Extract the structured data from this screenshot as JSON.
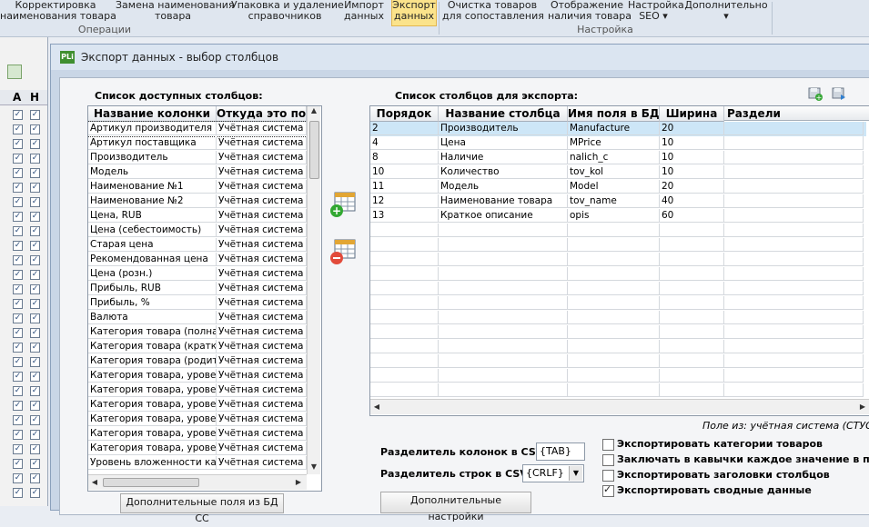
{
  "ribbon": {
    "buttons": [
      {
        "label": "Корректировка\nнаименования товара",
        "active": false
      },
      {
        "label": "Замена наименования\nтовара",
        "active": false
      },
      {
        "label": "Упаковка и удаление\nсправочников",
        "active": false
      },
      {
        "label": "Импорт\nданных",
        "active": false
      },
      {
        "label": "Экспорт\nданных",
        "active": true
      },
      {
        "label": "Очистка товаров\nдля сопоставления",
        "active": false
      },
      {
        "label": "Отображение\nналичия товара",
        "active": false
      },
      {
        "label": "Настройка\nSEO ▾",
        "active": false
      },
      {
        "label": "Дополнительно\n▾",
        "active": false
      }
    ],
    "groups": {
      "operations": "Операции",
      "settings": "Настройка"
    }
  },
  "background": {
    "col_a": "A",
    "col_h": "H"
  },
  "dialog": {
    "app_icon": "PLi",
    "title": "Экспорт данных - выбор столбцов",
    "left_label": "Список доступных столбцов:",
    "right_label": "Список столбцов для экспорта:",
    "left_grid": {
      "headers": [
        "Название колонки",
        "Откуда это пол"
      ],
      "rows": [
        [
          "Артикул производителя",
          "Учётная система"
        ],
        [
          "Артикул поставщика",
          "Учётная система"
        ],
        [
          "Производитель",
          "Учётная система"
        ],
        [
          "Модель",
          "Учётная система"
        ],
        [
          "Наименование №1",
          "Учётная система"
        ],
        [
          "Наименование №2",
          "Учётная система"
        ],
        [
          "Цена, RUB",
          "Учётная система"
        ],
        [
          "Цена (себестоимость)",
          "Учётная система"
        ],
        [
          "Старая цена",
          "Учётная система"
        ],
        [
          "Рекомендованная цена",
          "Учётная система"
        ],
        [
          "Цена (розн.)",
          "Учётная система"
        ],
        [
          "Прибыль, RUB",
          "Учётная система"
        ],
        [
          "Прибыль, %",
          "Учётная система"
        ],
        [
          "Валюта",
          "Учётная система"
        ],
        [
          "Категория товара (полная)",
          "Учётная система"
        ],
        [
          "Категория товара (кратка",
          "Учётная система"
        ],
        [
          "Категория товара (родите",
          "Учётная система"
        ],
        [
          "Категория товара, уровень",
          "Учётная система"
        ],
        [
          "Категория товара, уровень",
          "Учётная система"
        ],
        [
          "Категория товара, уровень",
          "Учётная система"
        ],
        [
          "Категория товара, уровень",
          "Учётная система"
        ],
        [
          "Категория товара, уровень",
          "Учётная система"
        ],
        [
          "Категория товара, уровень",
          "Учётная система"
        ],
        [
          "Уровень вложенности кате",
          "Учётная система"
        ]
      ]
    },
    "right_grid": {
      "headers": [
        "Порядок",
        "Название столбца",
        "Имя поля в БД",
        "Ширина",
        "Раздели"
      ],
      "rows": [
        [
          "2",
          "Производитель",
          "Manufacture",
          "20",
          ""
        ],
        [
          "4",
          "Цена",
          "MPrice",
          "10",
          ""
        ],
        [
          "8",
          "Наличие",
          "nalich_c",
          "10",
          ""
        ],
        [
          "10",
          "Количество",
          "tov_kol",
          "10",
          ""
        ],
        [
          "11",
          "Модель",
          "Model",
          "20",
          ""
        ],
        [
          "12",
          "Наименование товара",
          "tov_name",
          "40",
          ""
        ],
        [
          "13",
          "Краткое описание",
          "opis",
          "60",
          ""
        ]
      ]
    },
    "field_source": "Поле из:   учётная система (СТУС)",
    "col_sep_label": "Разделитель колонок в CSV:",
    "col_sep_value": "{TAB}",
    "row_sep_label": "Разделитель строк в CSV:",
    "row_sep_value": "{CRLF}",
    "checkboxes": [
      {
        "label": "Экспортировать категории товаров",
        "checked": false
      },
      {
        "label": "Заключать в кавычки каждое значение в поле",
        "checked": false
      },
      {
        "label": "Экспортировать заголовки столбцов",
        "checked": false
      },
      {
        "label": "Экспортировать сводные данные",
        "checked": true
      }
    ],
    "extra_fields_button": "Дополнительные поля из БД СС",
    "extra_settings_button": "Дополнительные настройки",
    "icons": {
      "add": "add-column-icon",
      "remove": "remove-column-icon",
      "save": "save-settings-icon",
      "load": "load-settings-icon"
    },
    "colors": {
      "selected_row": "#cde6f7",
      "accent": "#fbe38b"
    }
  }
}
